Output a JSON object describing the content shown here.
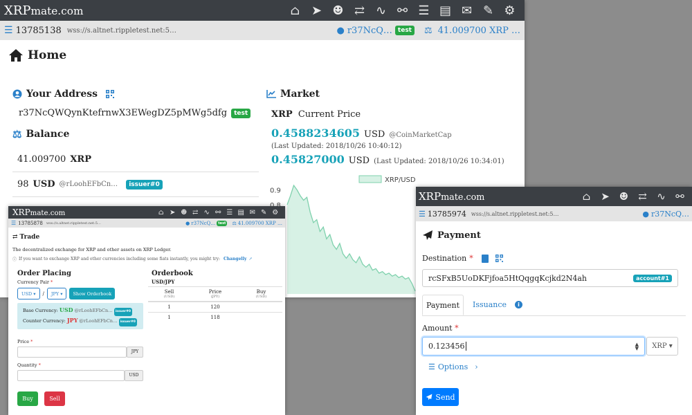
{
  "brand": {
    "name_bold": "XRP",
    "name_rest": "mate.com"
  },
  "nav_icons": [
    "home-icon",
    "send-icon",
    "user-lock-icon",
    "exchange-icon",
    "chart-icon",
    "handshake-icon",
    "list-icon",
    "address-book-icon",
    "comments-icon",
    "wrench-icon",
    "gear-icon"
  ],
  "status": {
    "ledger_index": "13785138",
    "server": "wss://s.altnet.rippletest.net:5…",
    "account_short": "r37NcQ…",
    "network_badge": "test",
    "balance": "41.009700 XRP …"
  },
  "home": {
    "title": "Home",
    "address_heading": "Your Address",
    "address": "r37NcQWQynKtefrnwX3EWegDZ5pMWg5dfg",
    "address_badge": "test",
    "balance_heading": "Balance",
    "balances": [
      {
        "amount": "41.009700",
        "currency": "XRP",
        "issuer": "",
        "badge": ""
      },
      {
        "amount": "98",
        "currency": "USD",
        "issuer": "@rLoohEFbCn…",
        "badge": "issuer#0"
      }
    ],
    "market_heading": "Market",
    "market_currency": "XRP",
    "market_label": "Current Price",
    "price1": "0.4588234605",
    "price1_currency": "USD",
    "price1_source": "@CoinMarketCap",
    "price1_updated": "(Last Updated: 2018/10/26 10:40:12)",
    "price2": "0.45827000",
    "price2_currency": "USD",
    "price2_updated": "(Last Updated: 2018/10/26 10:34:01)"
  },
  "chart_data": {
    "type": "area",
    "legend": "XRP/USD",
    "yticks": [
      "0.9",
      "0.8"
    ],
    "ylim": [
      0.2,
      0.93
    ],
    "values": [
      0.8,
      0.86,
      0.93,
      0.9,
      0.86,
      0.83,
      0.85,
      0.75,
      0.68,
      0.7,
      0.62,
      0.65,
      0.57,
      0.6,
      0.53,
      0.5,
      0.54,
      0.47,
      0.44,
      0.47,
      0.43,
      0.41,
      0.45,
      0.4,
      0.38,
      0.4,
      0.36,
      0.37,
      0.34,
      0.35,
      0.33,
      0.34,
      0.32,
      0.33,
      0.31,
      0.32,
      0.3,
      0.31,
      0.27,
      0.22
    ],
    "color": "#7fd1ad"
  },
  "trade": {
    "status": {
      "ledger_index": "13785878",
      "server": "wss://s.altnet.rippletest.net:5…",
      "account_short": "r37NcQ…",
      "network_badge": "test",
      "balance": "41.009700 XRP …"
    },
    "title": "Trade",
    "description": "The decentralized exchange for XRP and other assets on XRP Ledger.",
    "info": "If you want to exchange XRP and other currencies including some fiats instantly, you might try:",
    "info_link": "Changelly",
    "order_heading": "Order Placing",
    "pair_label": "Currency Pair",
    "base": "USD",
    "slash": "/",
    "counter": "JPY",
    "show_orderbook": "Show Orderbook",
    "base_label": "Base Currency:",
    "base_currency": "USD",
    "base_issuer": "@rLoohEFbCn…",
    "base_badge": "issuer#0",
    "counter_label": "Counter Currency:",
    "counter_currency": "JPY",
    "counter_issuer": "@rLoohEFbCn…",
    "counter_badge": "issuer#0",
    "price_label": "Price",
    "price_unit": "JPY",
    "quantity_label": "Quantity",
    "quantity_unit": "USD",
    "buy": "Buy",
    "sell": "Sell",
    "orderbook_heading": "Orderbook",
    "orderbook_pair": "USD/JPY",
    "orderbook_columns": [
      {
        "label": "Sell",
        "unit": "(USD)"
      },
      {
        "label": "Price",
        "unit": "(JPY)"
      },
      {
        "label": "Buy",
        "unit": "(USD)"
      }
    ],
    "orderbook_rows": [
      {
        "sell": "1",
        "price": "120",
        "buy": ""
      },
      {
        "sell": "1",
        "price": "118",
        "buy": ""
      }
    ]
  },
  "payment": {
    "status": {
      "ledger_index": "13785974",
      "server": "wss://s.altnet.rippletest.net:5…",
      "account_short": "r37NcQ…"
    },
    "title": "Payment",
    "destination_label": "Destination",
    "destination_value": "rcSFxB5UoDKFjfoa5HtQqgqKcjkd2N4ah",
    "destination_badge": "account#1",
    "tabs": [
      "Payment",
      "Issuance"
    ],
    "amount_label": "Amount",
    "amount_value": "0.123456",
    "amount_currency": "XRP",
    "options": "Options",
    "send": "Send",
    "required_mark": "*"
  }
}
